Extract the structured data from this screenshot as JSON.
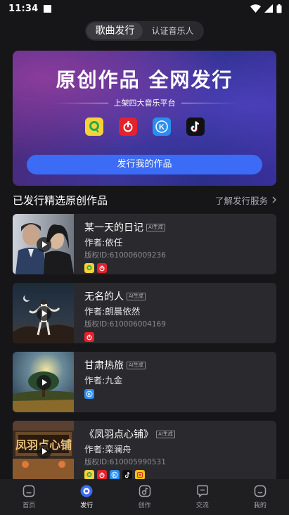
{
  "status": {
    "time": "11:34"
  },
  "segment": {
    "tabs": [
      {
        "label": "歌曲发行"
      },
      {
        "label": "认证音乐人"
      }
    ]
  },
  "banner": {
    "title": "原创作品 全网发行",
    "subtitle": "上架四大音乐平台",
    "cta": "发行我的作品",
    "platforms": [
      "qq-music-icon",
      "netease-music-icon",
      "kugou-music-icon",
      "tiktok-icon"
    ]
  },
  "section": {
    "title": "已发行精选原创作品",
    "link": "了解发行服务"
  },
  "songs": [
    {
      "title": "某一天的日记",
      "tag": "AI生成",
      "author": "作者:依任",
      "copyright": "版权ID:610006009236",
      "platforms": [
        "qq-music-icon",
        "netease-music-icon"
      ]
    },
    {
      "title": "无名的人",
      "tag": "AI生成",
      "author": "作者:朗晨依然",
      "copyright": "版权ID:610006004169",
      "platforms": [
        "netease-music-icon"
      ]
    },
    {
      "title": "甘肃热旅",
      "tag": "AI生成",
      "author": "作者:九金",
      "copyright": "",
      "platforms": [
        "kugou-music-icon"
      ]
    },
    {
      "title": "《凤羽点心铺》",
      "tag": "AI生成",
      "author": "作者:栾澜舟",
      "copyright": "版权ID:610005990531",
      "platforms": [
        "qq-music-icon",
        "netease-music-icon",
        "kugou-music-icon",
        "tiktok-icon",
        "kuwo-music-icon"
      ]
    }
  ],
  "nav": [
    {
      "label": "首页",
      "icon": "home-icon"
    },
    {
      "label": "发行",
      "icon": "release-icon",
      "active": true
    },
    {
      "label": "创作",
      "icon": "create-icon"
    },
    {
      "label": "交流",
      "icon": "chat-icon"
    },
    {
      "label": "我的",
      "icon": "profile-icon"
    }
  ],
  "colors": {
    "accent": "#3c6cf5",
    "background": "#161618",
    "card": "#2a2a2e"
  }
}
